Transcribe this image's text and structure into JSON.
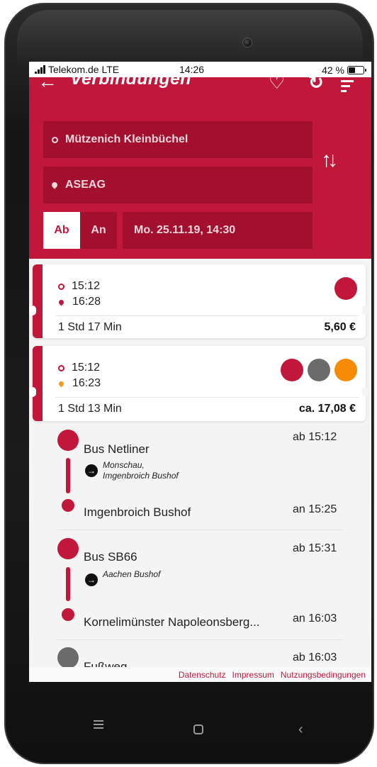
{
  "status_bar": {
    "carrier": "Telekom.de LTE",
    "time": "14:26",
    "battery": "42 %",
    "battery_level": 0.42
  },
  "header": {
    "back_icon": "arrow-left-icon",
    "title": "Verbindungen",
    "favorite_icon": "heart-icon",
    "refresh_icon": "refresh-icon",
    "filter_icon": "filter-icon"
  },
  "search": {
    "from": "Mützenich Kleinbüchel",
    "to": "ASEAG",
    "swap_icon": "swap-icon",
    "tab_departure": "Ab",
    "tab_arrival": "An",
    "active_tab": "Ab",
    "datetime": "Mo. 25.11.19, 14:30"
  },
  "connections": [
    {
      "departure": "15:12",
      "arrival": "16:28",
      "duration": "1 Std 17 Min",
      "price": "5,60 €",
      "products": [
        "#c0173a"
      ]
    },
    {
      "departure": "15:12",
      "arrival": "16:23",
      "duration": "1 Std 13 Min",
      "price": "ca. 17,08 €",
      "products": [
        "#c0173a",
        "#6b6b6b",
        "#f58a07"
      ]
    }
  ],
  "legs": [
    {
      "name": "Bus Netliner",
      "dep_time": "ab 15:12",
      "direction": "Monschau, Imgenbroich Bushof",
      "direction_line1": "Monschau,",
      "direction_line2": "Imgenbroich Bushof",
      "stop": "Imgenbroich Bushof",
      "arr_time": "an 15:25"
    },
    {
      "name": "Bus SB66",
      "dep_time": "ab 15:31",
      "direction": "Aachen Bushof",
      "stop": "Kornelimünster Napoleonsberg...",
      "arr_time": "an 16:03"
    },
    {
      "name": "Fußweg",
      "dep_time": "ab 16:03"
    }
  ],
  "footer": {
    "privacy": "Datenschutz",
    "imprint": "Impressum",
    "terms": "Nutzungsbedingungen"
  },
  "colors": {
    "brand": "#c0173a",
    "brand_dark": "#a3102f",
    "walk": "#6b6b6b",
    "accent_orange": "#f58a07"
  }
}
